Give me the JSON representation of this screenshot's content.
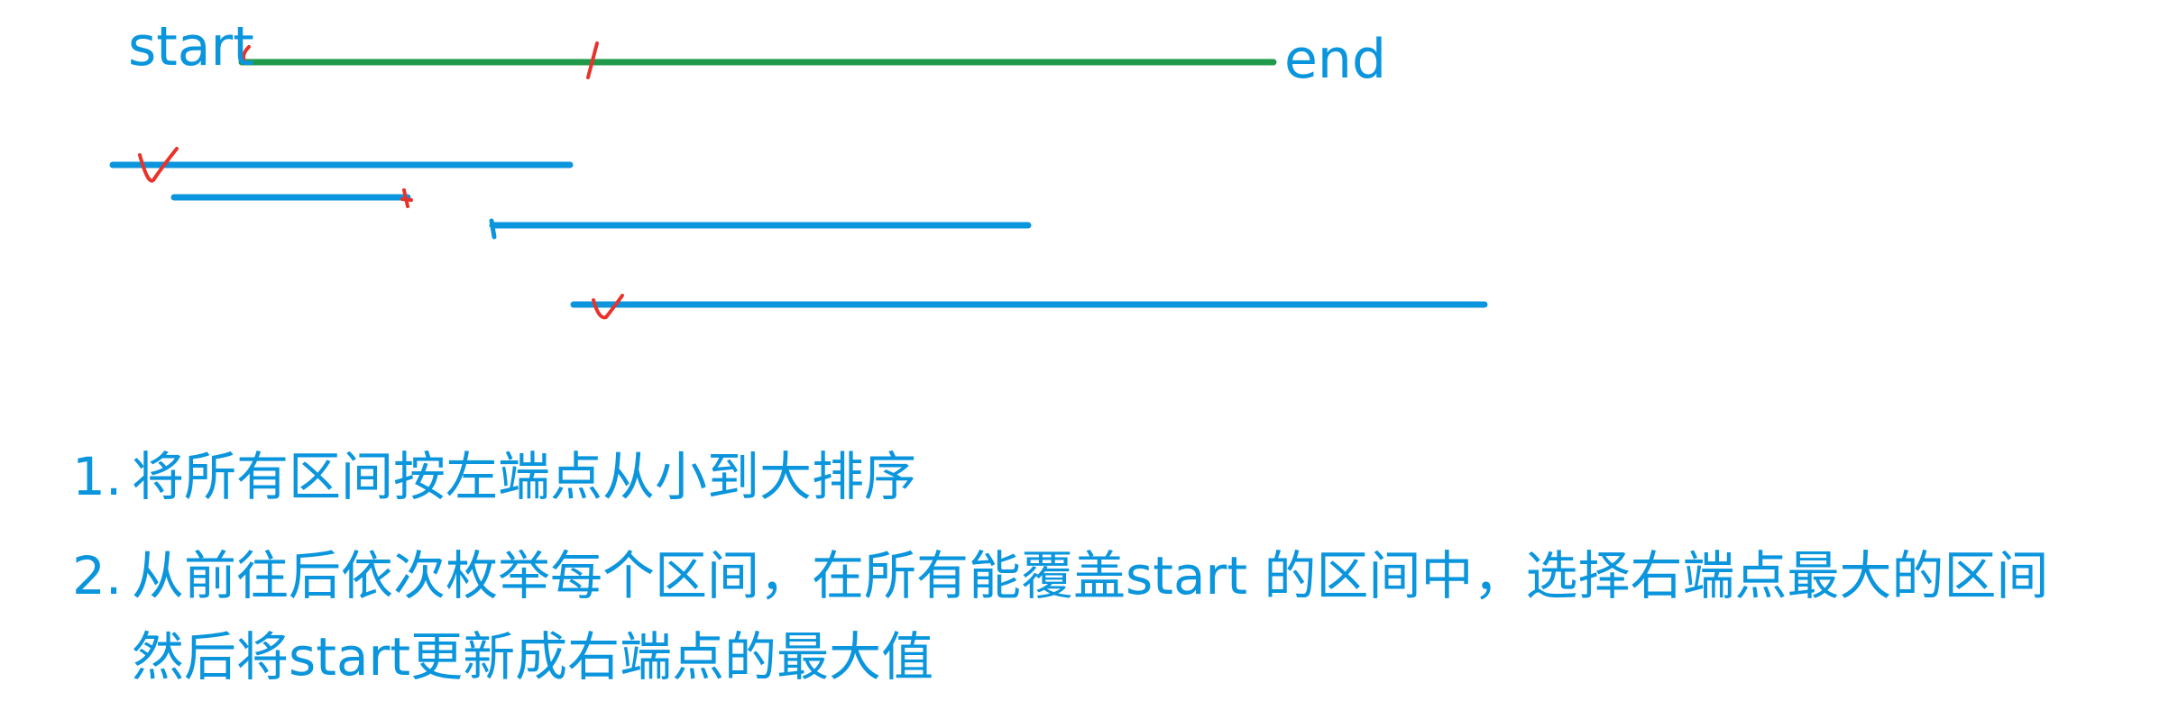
{
  "labels": {
    "start": "start",
    "end": "end"
  },
  "steps": [
    {
      "number": "1.",
      "text": "将所有区间按左端点从小到大排序"
    },
    {
      "number": "2.",
      "text": "从前往后依次枚举每个区间，在所有能覆盖start 的区间中，选择右端点最大的区间"
    }
  ],
  "step2_continuation": "然后将start更新成右端点的最大值",
  "colors": {
    "target": "#1f9a4a",
    "interval": "#0a95dd",
    "mark": "#e8332a",
    "text": "#0a95dd",
    "background": "#ffffff"
  }
}
